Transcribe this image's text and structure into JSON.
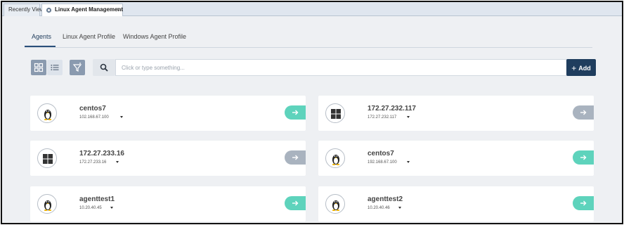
{
  "window_tabs": [
    {
      "label": "Recently View"
    },
    {
      "label": "Linux Agent Management",
      "close": "×"
    }
  ],
  "page_tabs": [
    {
      "label": "Agents",
      "active": true
    },
    {
      "label": "Linux Agent Profile"
    },
    {
      "label": "Windows Agent Profile"
    }
  ],
  "toolbar": {
    "search_placeholder": "Click or type something...",
    "add_label": "Add"
  },
  "agents": [
    {
      "name": "centos7",
      "ip": "102.168.67.100",
      "os": "linux-icon",
      "status": "teal"
    },
    {
      "name": "172.27.232.117",
      "ip": "172.27.232.117",
      "os": "windows-icon",
      "status": "gray"
    },
    {
      "name": "172.27.233.16",
      "ip": "172.27.233.16",
      "os": "windows-icon",
      "status": "gray"
    },
    {
      "name": "centos7",
      "ip": "192.168.67.100",
      "os": "linux-icon",
      "status": "teal"
    },
    {
      "name": "agenttest1",
      "ip": "10.20.40.45",
      "os": "linux-icon",
      "status": "teal"
    },
    {
      "name": "agenttest2",
      "ip": "10.20.40.46",
      "os": "linux-icon",
      "status": "teal"
    }
  ],
  "colors": {
    "accent": "#1f3d5e",
    "go_active": "#5ed3bc",
    "go_inactive": "#a9b3bf",
    "background": "#eef0f3"
  }
}
